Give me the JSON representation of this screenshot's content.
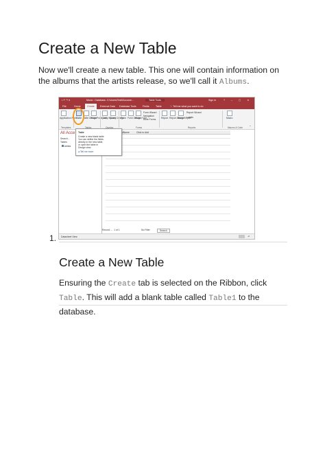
{
  "heading1": "Create a New Table",
  "para1": {
    "text": "Now we'll create a new table. This one will contain information on the albums that the artists release, so we'll call it ",
    "code": "Albums",
    "end": "."
  },
  "list_number": "1.",
  "heading2": "Create a New Table",
  "para2": {
    "t1": "Ensuring the ",
    "code1": "Create",
    "t2": " tab is selected on the Ribbon, click ",
    "code2": "Table",
    "t3": ". This will add a blank table called ",
    "code3": "Table1",
    "t4": " to the database."
  },
  "screenshot": {
    "title": "Music : Database- C:\\Users\\Test\\Docume...",
    "contextual_tab": "Table Tools",
    "signin": "Sign in",
    "tabs": [
      "File",
      "Home",
      "Create",
      "External Data",
      "Database Tools",
      "Fields",
      "Table"
    ],
    "tell_me": "Tell me what you want to do",
    "ribbon_buttons": [
      "Application Parts",
      "Table",
      "Table Design",
      "SharePoint Lists",
      "Query Wizard",
      "Query Design",
      "Form",
      "Form Design",
      "Blank Form",
      "Report",
      "Report Design",
      "Blank Report",
      "Macro"
    ],
    "ribbon_small": [
      "Form Wizard",
      "Navigation",
      "More Forms",
      "Report Wizard",
      "Labels"
    ],
    "groups": [
      "Templates",
      "Tables",
      "Queries",
      "Forms",
      "Reports",
      "Macros & Code"
    ],
    "nav_title": "All Acce",
    "nav_search": "Search...",
    "nav_section": "Tables",
    "nav_item": "Artists",
    "col_headers": [
      "ArtistName",
      "Click to Add"
    ],
    "new_row": "(New)",
    "tooltip": {
      "title": "Table",
      "body": "Create a new blank table. You can define the fields directly in the new table, or open the table in Design view.",
      "link": "Tell me more"
    },
    "record_nav": "Record: ← 1 of 1",
    "no_filter": "No Filter",
    "search": "Search",
    "status": "Datasheet View"
  }
}
